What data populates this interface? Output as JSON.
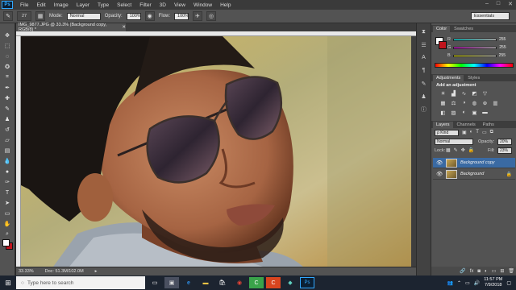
{
  "menubar": {
    "logo": "Ps",
    "items": [
      "File",
      "Edit",
      "Image",
      "Layer",
      "Type",
      "Select",
      "Filter",
      "3D",
      "View",
      "Window",
      "Help"
    ],
    "window_controls": [
      "–",
      "□",
      "✕"
    ]
  },
  "options_bar": {
    "brush_size": "27",
    "mode_label": "Mode:",
    "mode_value": "Normal",
    "opacity_label": "Opacity:",
    "opacity_value": "100%",
    "flow_label": "Flow:",
    "flow_value": "100%",
    "workspace": "Essentials"
  },
  "document": {
    "tab_title": "IMG_9877.JPG @ 33.3% (Background copy, RGB/8) *",
    "zoom": "33.33%",
    "doc_info": "Doc: 51.3M/102.0M"
  },
  "color_panel": {
    "tabs": [
      "Color",
      "Swatches"
    ],
    "fg_color": "#ffffff",
    "rows": [
      {
        "label": "R",
        "value": "255"
      },
      {
        "label": "G",
        "value": "255"
      },
      {
        "label": "B",
        "value": "255"
      }
    ]
  },
  "adjustments_panel": {
    "tabs": [
      "Adjustments",
      "Styles"
    ],
    "heading": "Add an adjustment"
  },
  "layers_panel": {
    "tabs": [
      "Layers",
      "Channels",
      "Paths"
    ],
    "kind_filter": "ρ Kind",
    "blend_mode": "Normal",
    "opacity_label": "Opacity:",
    "opacity_value": "20%",
    "lock_label": "Lock:",
    "fill_label": "Fill:",
    "fill_value": "23%",
    "layers": [
      {
        "name": "Background copy",
        "selected": true
      },
      {
        "name": "Background",
        "selected": false
      }
    ]
  },
  "taskbar": {
    "search_placeholder": "Type here to search",
    "time": "11:57 PM",
    "date": "7/9/2018"
  },
  "colors": {
    "accent": "#31a8ff",
    "selected_layer": "#3a6aa3",
    "background_swatch": "#c0141d"
  }
}
